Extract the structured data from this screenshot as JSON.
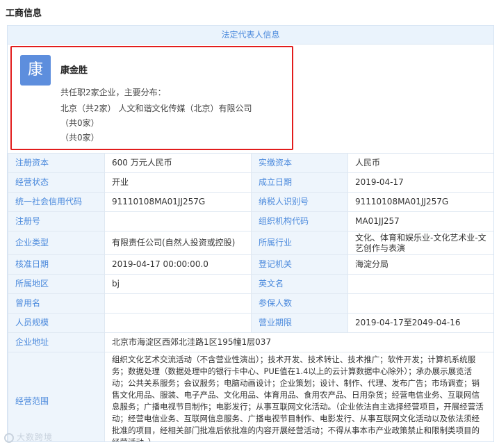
{
  "section_title": "工商信息",
  "legal_header": "法定代表人信息",
  "person": {
    "avatar_char": "康",
    "name": "康金胜",
    "summary": "共任职2家企业，主要分布：",
    "line1": "北京（共2家） 人文和谐文化传媒（北京）有限公司",
    "line2": "（共0家）",
    "line3": "（共0家）"
  },
  "rows": {
    "reg_capital": {
      "label": "注册资本",
      "value": "600 万元人民币"
    },
    "paid_capital": {
      "label": "实缴资本",
      "value": "人民币"
    },
    "status": {
      "label": "经营状态",
      "value": "开业"
    },
    "est_date": {
      "label": "成立日期",
      "value": "2019-04-17"
    },
    "credit_code": {
      "label": "统一社会信用代码",
      "value": "91110108MA01JJ257G"
    },
    "taxpayer_id": {
      "label": "纳税人识别号",
      "value": "91110108MA01JJ257G"
    },
    "reg_no": {
      "label": "注册号",
      "value": ""
    },
    "org_code": {
      "label": "组织机构代码",
      "value": "MA01JJ257"
    },
    "company_type": {
      "label": "企业类型",
      "value": "有限责任公司(自然人投资或控股)"
    },
    "industry": {
      "label": "所属行业",
      "value": "文化、体育和娱乐业-文化艺术业-文艺创作与表演"
    },
    "approve_date": {
      "label": "核准日期",
      "value": "2019-04-17 00:00:00.0"
    },
    "reg_authority": {
      "label": "登记机关",
      "value": "海淀分局"
    },
    "region": {
      "label": "所属地区",
      "value": "bj"
    },
    "english_name": {
      "label": "英文名",
      "value": ""
    },
    "former_name": {
      "label": "曾用名",
      "value": ""
    },
    "insured": {
      "label": "参保人数",
      "value": ""
    },
    "staff_size": {
      "label": "人员规模",
      "value": ""
    },
    "term": {
      "label": "营业期限",
      "value": "2019-04-17至2049-04-16"
    },
    "address": {
      "label": "企业地址",
      "value": "北京市海淀区西郊北洼路1区195幢1层037"
    },
    "scope": {
      "label": "经营范围",
      "value": "组织文化艺术交流活动（不含营业性演出）；技术开发、技术转让、技术推广；软件开发；计算机系统服务；数据处理（数据处理中的银行卡中心、PUE值在1.4以上的云计算数据中心除外）；承办展示展览活动；公共关系服务；会议服务；电脑动画设计；企业策划；设计、制作、代理、发布广告；市场调查；销售文化用品、服装、电子产品、文化用品、体育用品、食用农产品、日用杂货；经营电信业务、互联网信息服务；广播电视节目制作；电影发行；从事互联网文化活动。（企业依法自主选择经营项目，开展经营活动；经营电信业务、互联网信息服务、广播电视节目制作、电影发行、从事互联网文化活动以及依法须经批准的项目，经相关部门批准后依批准的内容开展经营活动；不得从事本市产业政策禁止和限制类项目的经营活动。）"
    }
  },
  "watermark": "大数跨境"
}
